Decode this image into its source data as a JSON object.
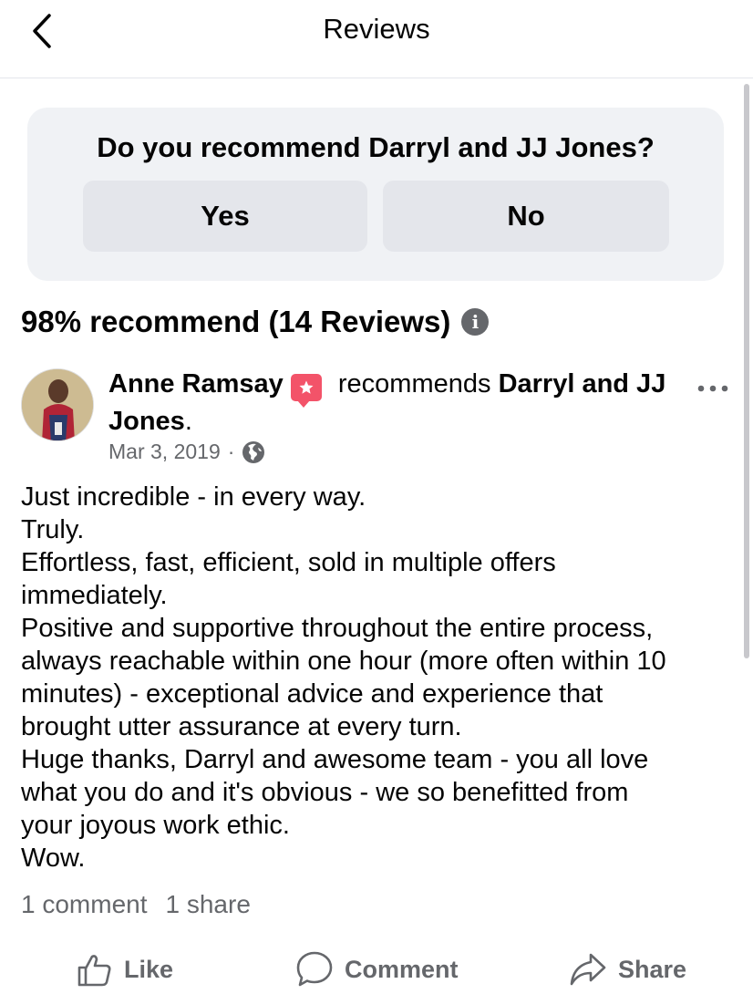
{
  "header": {
    "title": "Reviews",
    "back_icon": "chevron-left-icon"
  },
  "recommend_prompt": {
    "question": "Do you recommend Darryl and JJ Jones?",
    "yes_label": "Yes",
    "no_label": "No"
  },
  "summary": {
    "text": "98% recommend (14 Reviews)",
    "info_icon": "info-icon",
    "info_glyph": "i"
  },
  "review": {
    "author": "Anne Ramsay",
    "badge_icon": "star-badge-icon",
    "verb": "recommends",
    "page_name": "Darryl and JJ",
    "page_name_cont": "Jones",
    "period": ".",
    "date": "Mar 3, 2019",
    "separator": "·",
    "privacy_icon": "globe-icon",
    "body_lines": [
      "Just incredible - in every way.",
      "Truly.",
      "Effortless, fast, efficient, sold in multiple offers",
      "immediately.",
      "Positive and supportive throughout the entire process,",
      "always reachable within one hour (more often within 10",
      "minutes) - exceptional advice and experience that",
      "brought utter assurance at every turn.",
      "Huge thanks, Darryl and awesome team - you all love",
      "what you do and it's obvious - we so benefitted from",
      "your joyous work ethic.",
      "Wow."
    ],
    "comments": "1 comment",
    "shares": "1 share"
  },
  "actions": {
    "like": "Like",
    "comment": "Comment",
    "share": "Share"
  },
  "colors": {
    "card_bg": "#f0f2f5",
    "button_bg": "#e4e6eb",
    "secondary_text": "#65676b",
    "badge": "#f35369"
  }
}
